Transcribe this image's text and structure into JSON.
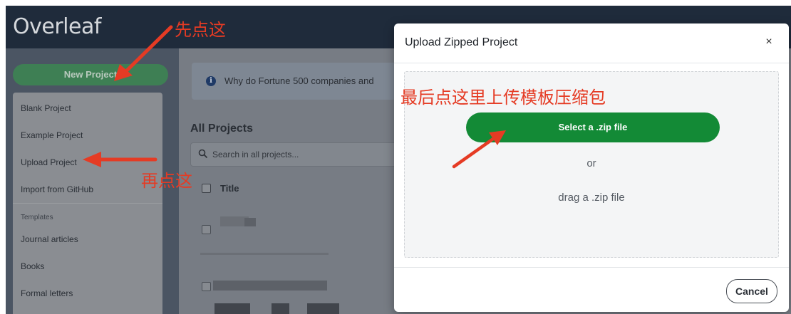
{
  "navbar": {
    "logo_text": "Overleaf"
  },
  "sidebar": {
    "new_project_label": "New Project",
    "menu": {
      "items": [
        "Blank Project",
        "Example Project",
        "Upload Project",
        "Import from GitHub"
      ],
      "templates_header": "Templates",
      "templates": [
        "Journal articles",
        "Books",
        "Formal letters"
      ]
    }
  },
  "main": {
    "banner_text": "Why do Fortune 500 companies and",
    "section_title": "All Projects",
    "search_placeholder": "Search in all projects...",
    "table_header": "Title"
  },
  "modal": {
    "title": "Upload Zipped Project",
    "close_glyph": "×",
    "select_button": "Select a .zip file",
    "or_text": "or",
    "drag_text": "drag a .zip file",
    "cancel_button": "Cancel"
  },
  "annotations": {
    "step1": "先点这",
    "step2": "再点这",
    "step3": "最后点这里上传模板压缩包"
  },
  "colors": {
    "accent_green": "#138a36",
    "annotation_red": "#e53b24",
    "navbar_bg": "#1f2b3b"
  },
  "icons": [
    "info-icon",
    "search-icon",
    "close-icon",
    "arrow-icon"
  ]
}
